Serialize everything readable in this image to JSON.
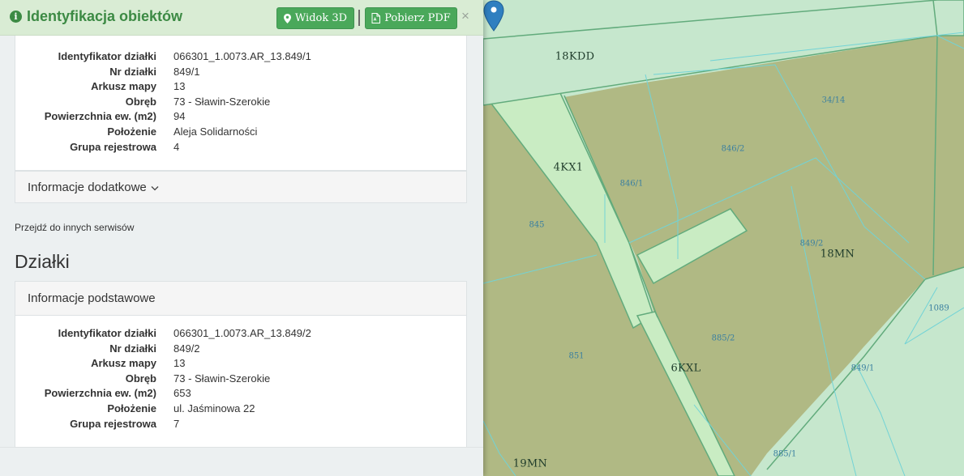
{
  "header": {
    "title": "Identyfikacja obiektów",
    "btn_3d": "Widok 3D",
    "btn_pdf": "Pobierz PDF",
    "close": "×"
  },
  "parcel1": {
    "rows": [
      {
        "k": "Identyfikator działki",
        "v": "066301_1.0073.AR_13.849/1"
      },
      {
        "k": "Nr działki",
        "v": "849/1"
      },
      {
        "k": "Arkusz mapy",
        "v": "13"
      },
      {
        "k": "Obręb",
        "v": "73 - Sławin-Szerokie"
      },
      {
        "k": "Powierzchnia ew. (m2)",
        "v": "94"
      },
      {
        "k": "Położenie",
        "v": "Aleja Solidarności"
      },
      {
        "k": "Grupa rejestrowa",
        "v": "4"
      }
    ]
  },
  "extra": {
    "label": "Informacje dodatkowe",
    "chevron": "⌄"
  },
  "goto": "Przejdź do innych serwisów",
  "section_title": "Działki",
  "parcel2": {
    "header": "Informacje podstawowe",
    "rows": [
      {
        "k": "Identyfikator działki",
        "v": "066301_1.0073.AR_13.849/2"
      },
      {
        "k": "Nr działki",
        "v": "849/2"
      },
      {
        "k": "Arkusz mapy",
        "v": "13"
      },
      {
        "k": "Obręb",
        "v": "73 - Sławin-Szerokie"
      },
      {
        "k": "Powierzchnia ew. (m2)",
        "v": "653"
      },
      {
        "k": "Położenie",
        "v": "ul. Jaśminowa 22"
      },
      {
        "k": "Grupa rejestrowa",
        "v": "7"
      }
    ]
  },
  "map": {
    "zones": {
      "z_18kdd": "18KDD",
      "z_4kx1": "4KX1",
      "z_18mn": "18MN",
      "z_6kxl": "6KXL",
      "z_19mn": "19MN"
    },
    "parcels": {
      "p_3414": "34/14",
      "p_8462": "846/2",
      "p_8461": "846/1",
      "p_845": "845",
      "p_8492": "849/2",
      "p_1089": "1089",
      "p_8852": "885/2",
      "p_851": "851",
      "p_8491": "849/1",
      "p_8851": "885/1"
    },
    "colors": {
      "zone_fill": "#b0b984",
      "road_fill": "#c9ecc3",
      "background": "#c6e7cd",
      "zone_line": "#62ab7c",
      "parcel_line": "#72d3d6",
      "pin": "#2f7fc0"
    }
  }
}
